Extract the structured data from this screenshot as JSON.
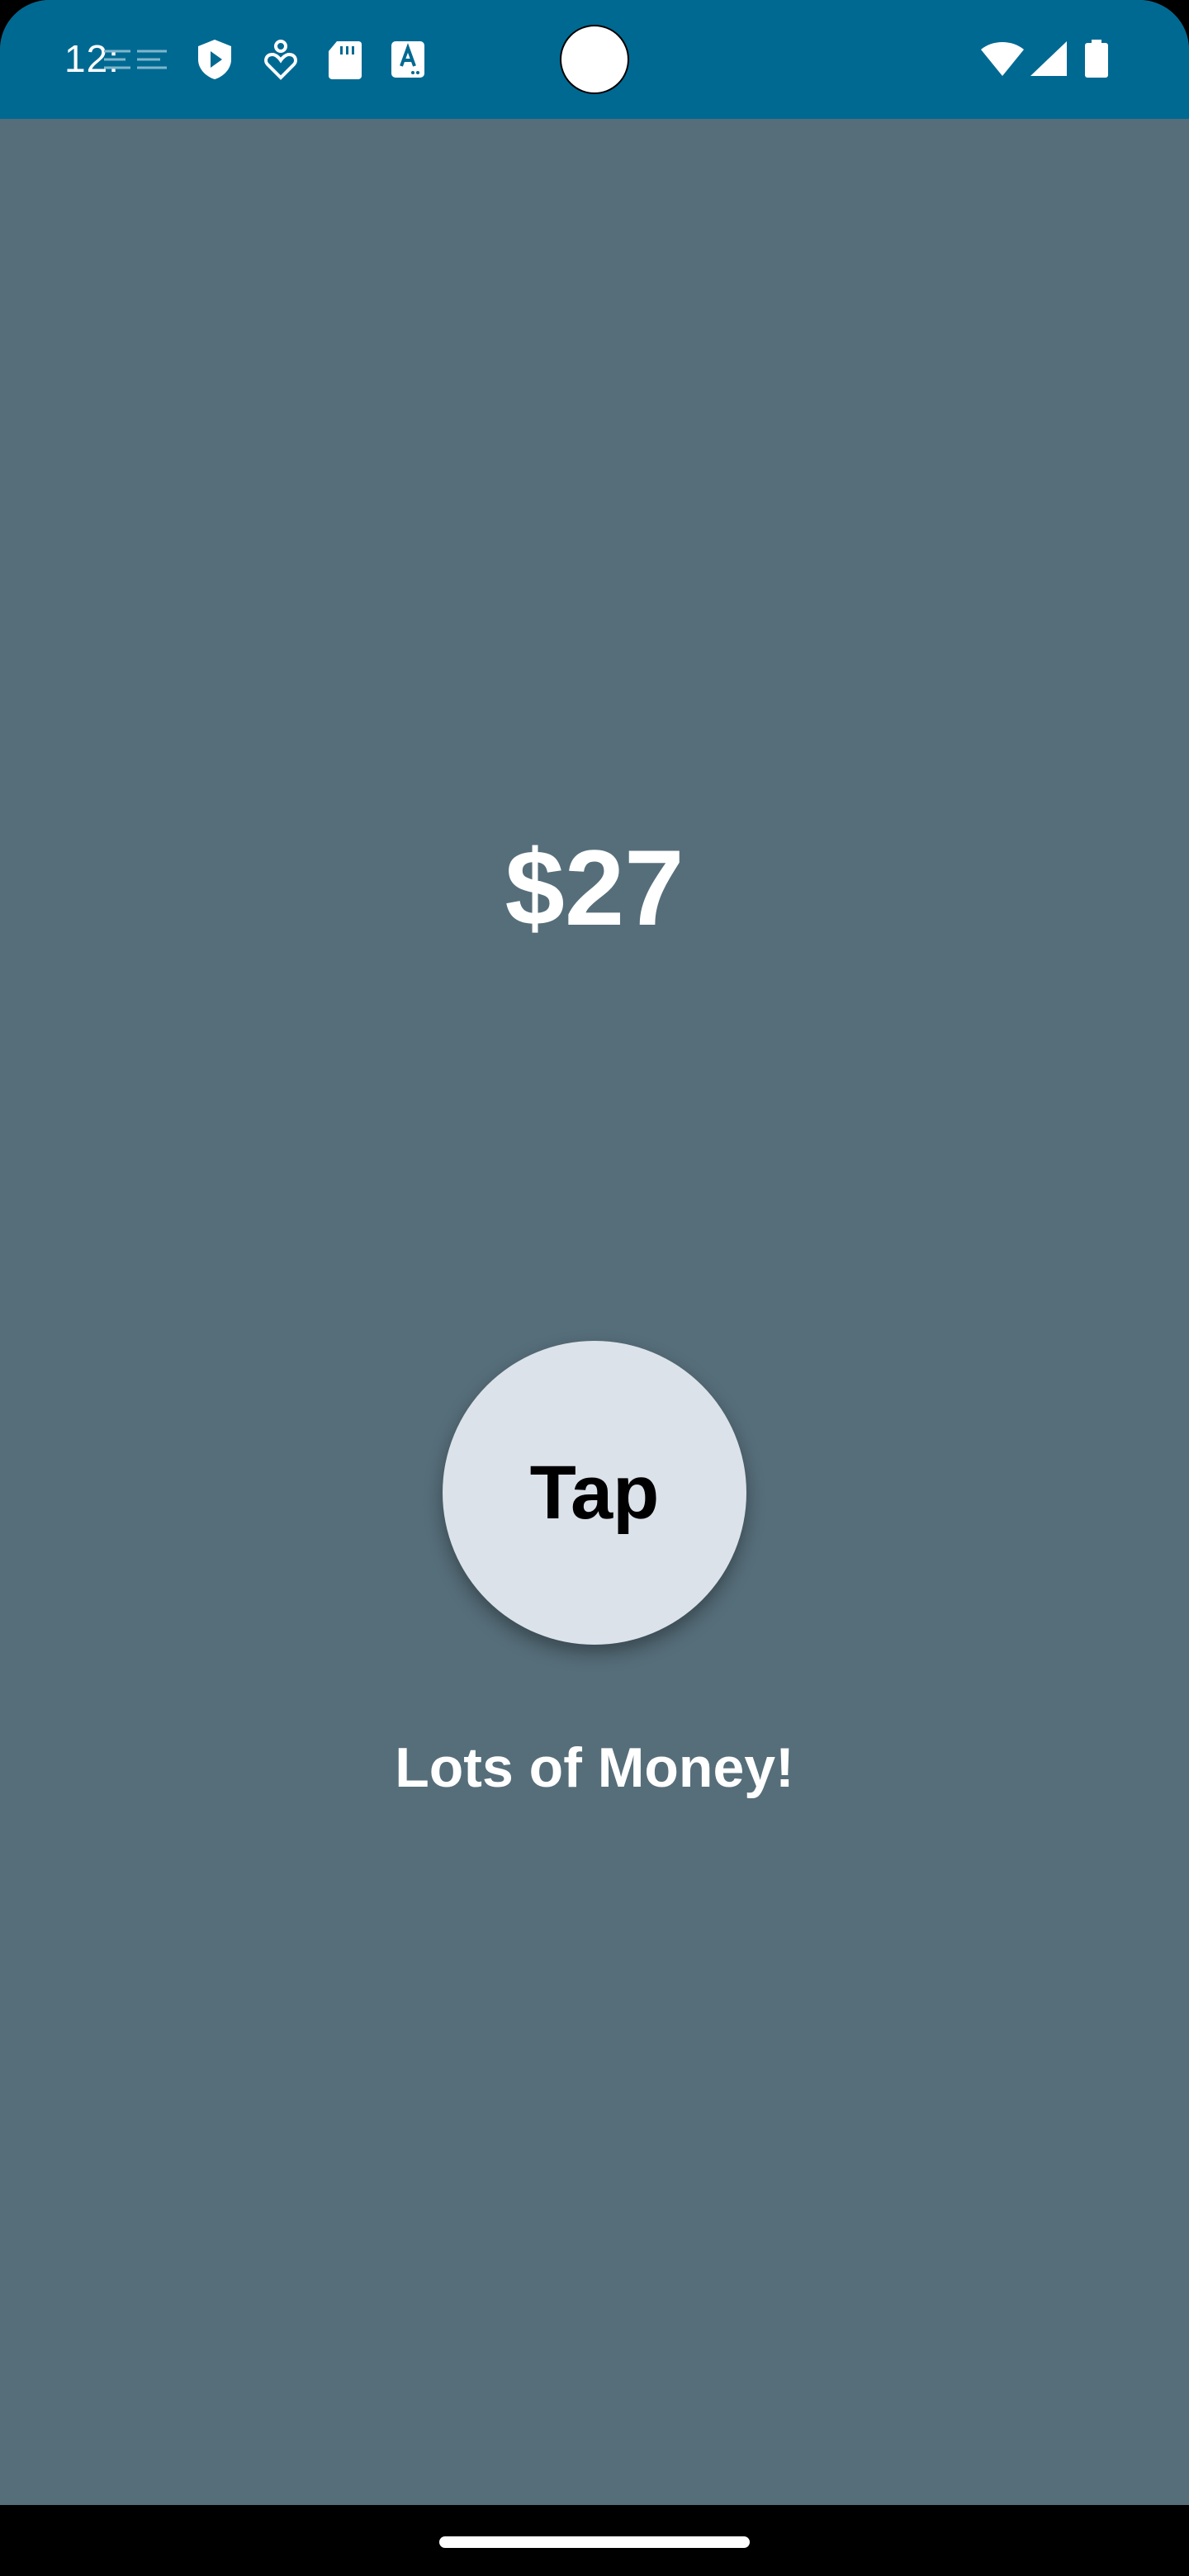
{
  "status_bar": {
    "time": "12:",
    "background": "#006992",
    "left_icons": [
      "play-shield-icon",
      "health-icon",
      "sd-card-icon",
      "text-a-icon"
    ],
    "right_icons": [
      "wifi-icon",
      "signal-icon",
      "battery-icon"
    ]
  },
  "main": {
    "background": "#566e7a",
    "amount": "$27",
    "button_label": "Tap",
    "message": "Lots of Money!"
  }
}
